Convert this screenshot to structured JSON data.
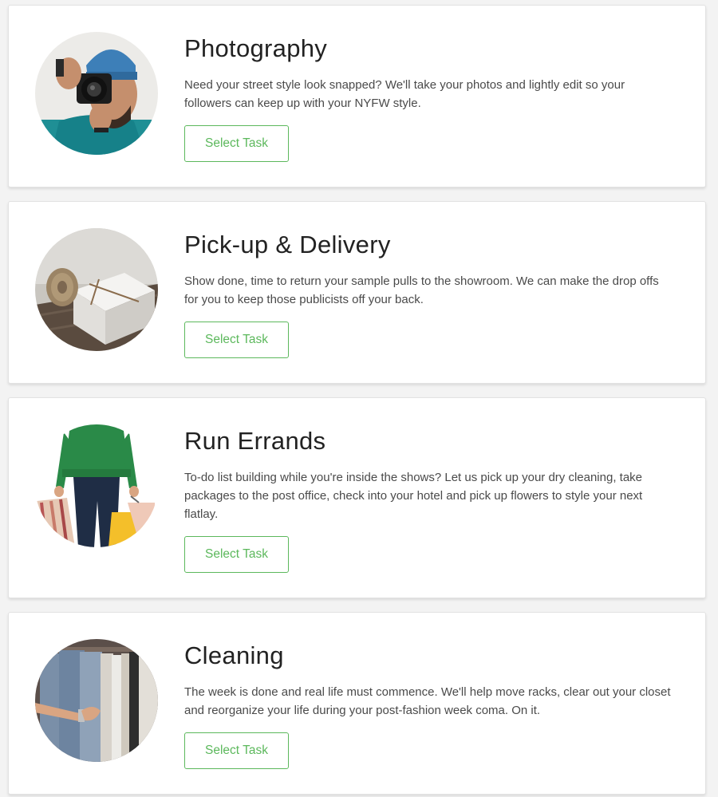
{
  "tasks": [
    {
      "title": "Photography",
      "description": "Need your street style look snapped? We'll take your photos and lightly edit so your followers can keep up with your NYFW style.",
      "button_label": "Select Task",
      "image_icon": "photographer-photo"
    },
    {
      "title": "Pick-up & Delivery",
      "description": "Show done, time to return your sample pulls to the showroom. We can make the drop offs for you to keep those publicists off your back.",
      "button_label": "Select Task",
      "image_icon": "boxes-and-twine-photo"
    },
    {
      "title": "Run Errands",
      "description": "To-do list building while you're inside the shows? Let us pick up your dry cleaning, take packages to the post office, check into your hotel and pick up flowers to style your next flatlay.",
      "button_label": "Select Task",
      "image_icon": "shopper-with-bags-photo"
    },
    {
      "title": "Cleaning",
      "description": "The week is done and real life must commence. We'll help move racks, clear out your closet and reorganize your life during your post-fashion week coma. On it.",
      "button_label": "Select Task",
      "image_icon": "clothing-rack-photo"
    }
  ],
  "colors": {
    "accent_green": "#5cb85c",
    "title_text": "#222222",
    "body_text": "#4a4a4a",
    "card_bg": "#ffffff",
    "page_bg": "#f3f3f3"
  }
}
